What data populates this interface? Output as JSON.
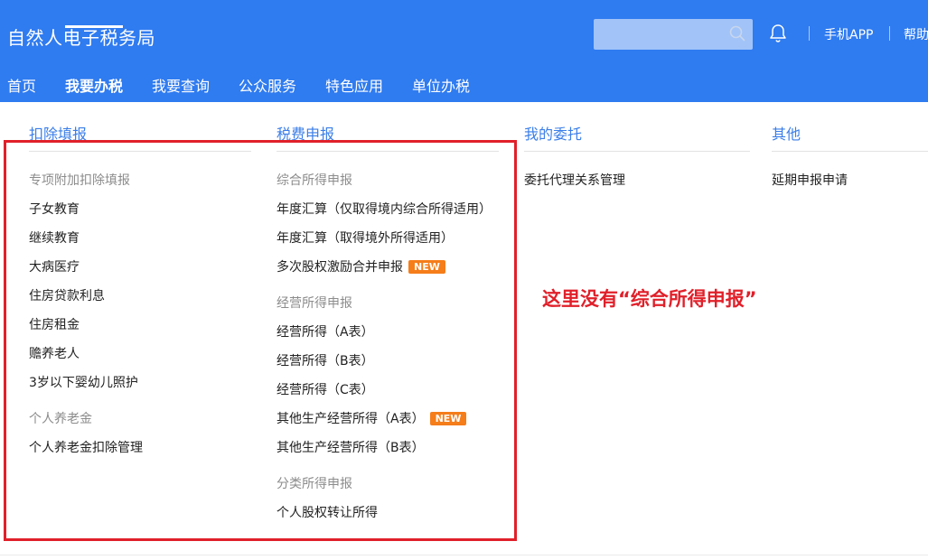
{
  "header": {
    "app_title": "自然人电子税务局",
    "search": {
      "placeholder": ""
    },
    "app_link": "手机APP",
    "help_link": "帮助"
  },
  "nav": {
    "items": [
      "首页",
      "我要办税",
      "我要查询",
      "公众服务",
      "特色应用",
      "单位办税"
    ],
    "active": "我要办税"
  },
  "menu": {
    "columns": [
      {
        "heading": "扣除填报",
        "groups": [
          {
            "title": "专项附加扣除填报",
            "items": [
              "子女教育",
              "继续教育",
              "大病医疗",
              "住房贷款利息",
              "住房租金",
              "赡养老人",
              "3岁以下婴幼儿照护"
            ]
          },
          {
            "title": "个人养老金",
            "items": [
              "个人养老金扣除管理"
            ]
          }
        ]
      },
      {
        "heading": "税费申报",
        "groups": [
          {
            "title": "综合所得申报",
            "items": [
              "年度汇算（仅取得境内综合所得适用）",
              "年度汇算（取得境外所得适用）",
              "多次股权激励合并申报"
            ]
          },
          {
            "title": "经营所得申报",
            "items": [
              "经营所得（A表）",
              "经营所得（B表）",
              "经营所得（C表）",
              "其他生产经营所得（A表）",
              "其他生产经营所得（B表）"
            ]
          },
          {
            "title": "分类所得申报",
            "items": [
              "个人股权转让所得"
            ]
          }
        ]
      },
      {
        "heading": "我的委托",
        "items": [
          "委托代理关系管理"
        ]
      },
      {
        "heading": "其他",
        "items": [
          "延期申报申请"
        ]
      }
    ],
    "new_badge": "NEW"
  },
  "annotation": "这里没有“综合所得申报”",
  "colors": {
    "header_bg": "#2f7bf0",
    "link_blue": "#3a7ee8",
    "badge": "#f57d1a",
    "annotation_red": "#e0202a"
  },
  "icons": [
    "search-icon",
    "bell-icon"
  ]
}
